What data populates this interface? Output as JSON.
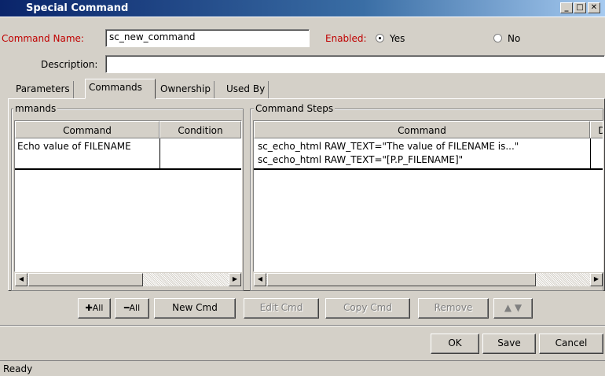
{
  "window": {
    "title": "Special Command",
    "minimize_glyph": "_",
    "maximize_glyph": "□",
    "close_glyph": "✕"
  },
  "form": {
    "command_name_label": "Command Name:",
    "command_name_value": "sc_new_command",
    "enabled_label": "Enabled:",
    "enabled_yes_label": "Yes",
    "enabled_no_label": "No",
    "enabled_selected": "Yes",
    "description_label": "Description:",
    "description_value": ""
  },
  "tabs": [
    {
      "label": "Parameters",
      "active": false
    },
    {
      "label": "Commands",
      "active": true
    },
    {
      "label": "Ownership",
      "active": false
    },
    {
      "label": "Used By",
      "active": false
    }
  ],
  "commands_group": {
    "title": "mmands",
    "columns": [
      "Command",
      "Condition"
    ],
    "rows": [
      {
        "command": "Echo value of FILENAME",
        "condition": ""
      }
    ]
  },
  "steps_group": {
    "title": "Command Steps",
    "columns": [
      "Command",
      "D"
    ],
    "rows": [
      "sc_echo_html RAW_TEXT=\"The value of FILENAME is...\"",
      "sc_echo_html RAW_TEXT=\"[P.P_FILENAME]\""
    ]
  },
  "toolbar": {
    "expand_all_label": "All",
    "collapse_all_label": "All",
    "new_cmd_label": "New Cmd",
    "edit_cmd_label": "Edit Cmd",
    "copy_cmd_label": "Copy Cmd",
    "remove_label": "Remove",
    "move_up_icon": "arrow-up-icon",
    "move_down_icon": "arrow-down-icon"
  },
  "footer": {
    "ok_label": "OK",
    "save_label": "Save",
    "cancel_label": "Cancel"
  },
  "status": {
    "text": "Ready"
  },
  "colors": {
    "title_bar": "#0a246a",
    "label_red": "#c00000",
    "face": "#d4d0c8"
  }
}
